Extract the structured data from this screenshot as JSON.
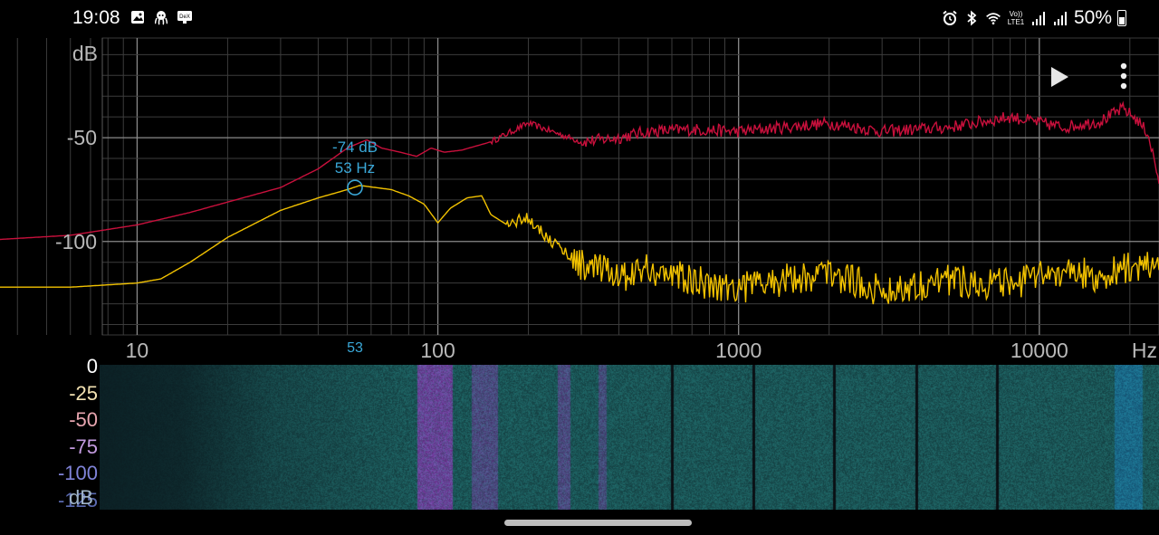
{
  "status_bar": {
    "time": "19:08",
    "left_icons": [
      "gallery-icon",
      "octopus-app-icon",
      "dex-icon"
    ],
    "right_icons": [
      "alarm-icon",
      "bluetooth-icon",
      "wifi-icon",
      "volte-lte1-icon",
      "signal-icon",
      "signal-icon"
    ],
    "volte_label": "Vo)) LTE1",
    "dex_label": "DeX",
    "battery": "50%"
  },
  "spectrum": {
    "y_unit": "dB",
    "x_unit": "Hz",
    "y_ticks": [
      {
        "value": -50,
        "label": "-50"
      },
      {
        "value": -100,
        "label": "-100"
      }
    ],
    "x_ticks": [
      {
        "value": 10,
        "label": "10"
      },
      {
        "value": 100,
        "label": "100"
      },
      {
        "value": 1000,
        "label": "1000"
      },
      {
        "value": 10000,
        "label": "10000"
      }
    ],
    "cursor": {
      "db_label": "-74 dB",
      "hz_label": "53 Hz",
      "x_axis_marker": "53",
      "hz": 53,
      "db": -74
    },
    "play_icon": "play-icon",
    "menu_icon": "more-vert-icon"
  },
  "chart_data": {
    "type": "line",
    "x_scale": "log",
    "xlim": [
      3.5,
      25000
    ],
    "ylim": [
      -145,
      -2
    ],
    "xlabel": "Hz",
    "ylabel": "dB",
    "grid": true,
    "series": [
      {
        "color": "#c8103c",
        "x": [
          3.5,
          6,
          10,
          15,
          20,
          30,
          40,
          50,
          58,
          65,
          75,
          85,
          95,
          105,
          120,
          150,
          200,
          300,
          400,
          500,
          700,
          1000,
          2000,
          3000,
          5000,
          8000,
          12000,
          16000,
          19000,
          21000,
          23000,
          25000
        ],
        "y": [
          -99,
          -97,
          -92,
          -86,
          -81,
          -74,
          -65,
          -55,
          -51,
          -55,
          -57,
          -59,
          -55,
          -57,
          -56,
          -52,
          -43,
          -52,
          -50,
          -47,
          -46,
          -47,
          -43,
          -47,
          -45,
          -40,
          -45,
          -42,
          -36,
          -41,
          -48,
          -71
        ]
      },
      {
        "color": "#f2c200",
        "x": [
          3.5,
          6,
          10,
          12,
          15,
          20,
          30,
          40,
          50,
          55,
          62,
          70,
          80,
          90,
          100,
          110,
          125,
          140,
          150,
          170,
          200,
          230,
          260,
          300,
          400,
          500,
          700,
          1000,
          2000,
          3000,
          5000,
          8000,
          12000,
          16000,
          20000,
          25000
        ],
        "y": [
          -122,
          -122,
          -120,
          -118,
          -110,
          -98,
          -85,
          -79,
          -75,
          -73,
          -74,
          -75,
          -78,
          -82,
          -91,
          -84,
          -79,
          -78,
          -87,
          -92,
          -88,
          -98,
          -104,
          -111,
          -117,
          -113,
          -119,
          -122,
          -115,
          -124,
          -118,
          -121,
          -114,
          -117,
          -112,
          -113
        ]
      }
    ]
  },
  "spectrogram": {
    "legend_labels": [
      {
        "label": "0",
        "color": "#ffffff"
      },
      {
        "label": "-25",
        "color": "#f3e2b2"
      },
      {
        "label": "-50",
        "color": "#e8a6b0"
      },
      {
        "label": "-75",
        "color": "#c39be0"
      },
      {
        "label": "-100",
        "color": "#7f83d8"
      },
      {
        "label": "-125",
        "color": "#5a6ab0"
      }
    ],
    "unit": "dB"
  }
}
